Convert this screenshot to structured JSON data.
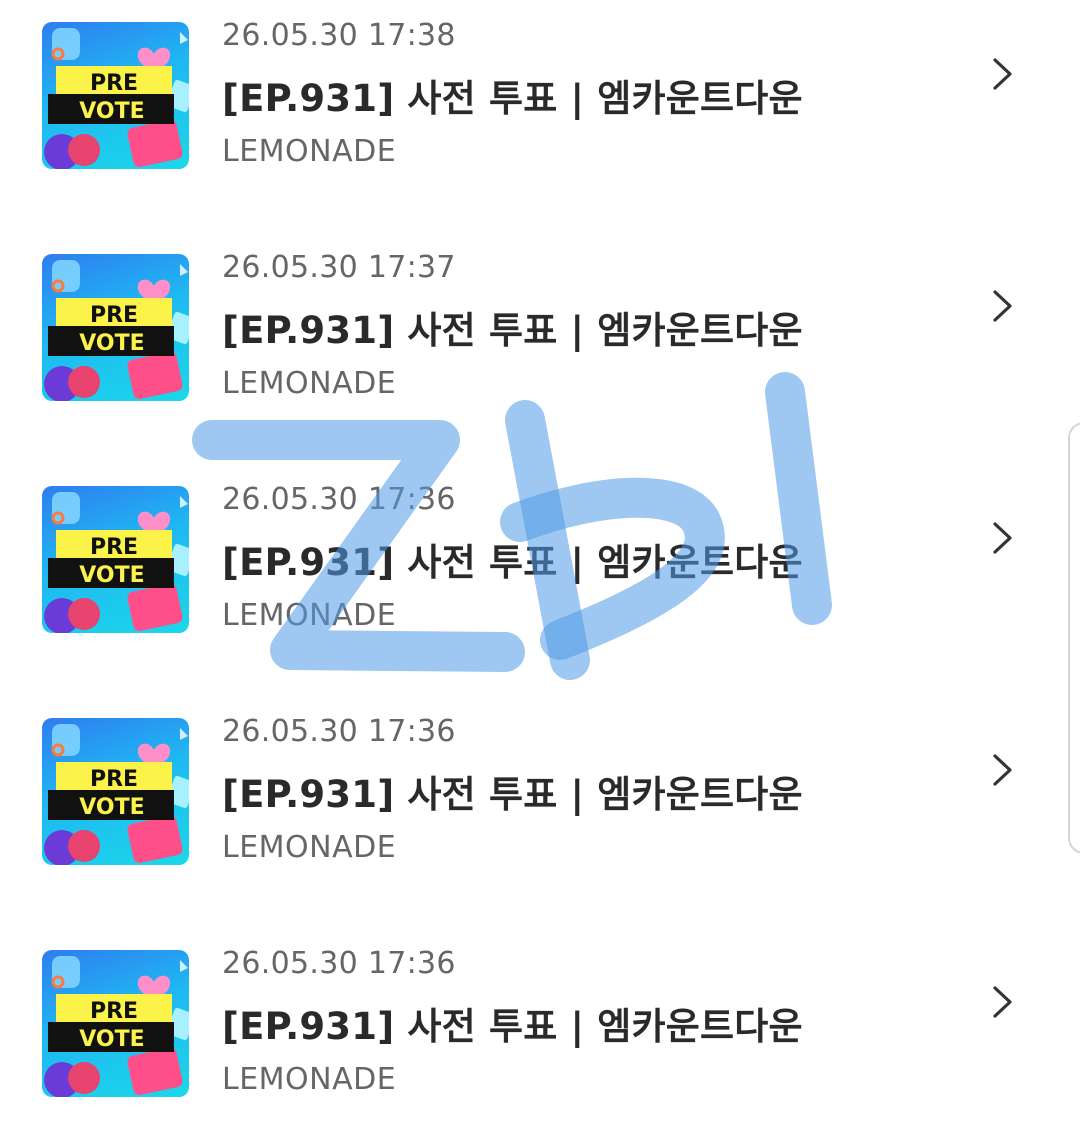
{
  "items": [
    {
      "date": "26.05.30 17:38",
      "title": "[EP.931] 사전 투표 | 엠카운트다운",
      "source": "LEMONADE",
      "thumb": {
        "line1": "PRE",
        "line2": "VOTE"
      }
    },
    {
      "date": "26.05.30 17:37",
      "title": "[EP.931] 사전 투표 | 엠카운트다운",
      "source": "LEMONADE",
      "thumb": {
        "line1": "PRE",
        "line2": "VOTE"
      }
    },
    {
      "date": "26.05.30 17:36",
      "title": "[EP.931] 사전 투표 | 엠카운트다운",
      "source": "LEMONADE",
      "thumb": {
        "line1": "PRE",
        "line2": "VOTE"
      }
    },
    {
      "date": "26.05.30 17:36",
      "title": "[EP.931] 사전 투표 | 엠카운트다운",
      "source": "LEMONADE",
      "thumb": {
        "line1": "PRE",
        "line2": "VOTE"
      }
    },
    {
      "date": "26.05.30 17:36",
      "title": "[EP.931] 사전 투표 | 엠카운트다운",
      "source": "LEMONADE",
      "thumb": {
        "line1": "PRE",
        "line2": "VOTE"
      }
    }
  ],
  "watermark": {
    "color": "#4f9be6"
  },
  "colors": {
    "title": "#2a2a2a",
    "meta": "#666666",
    "chevron": "#333333"
  },
  "icons": {
    "chevron": "chevron-right-icon"
  }
}
